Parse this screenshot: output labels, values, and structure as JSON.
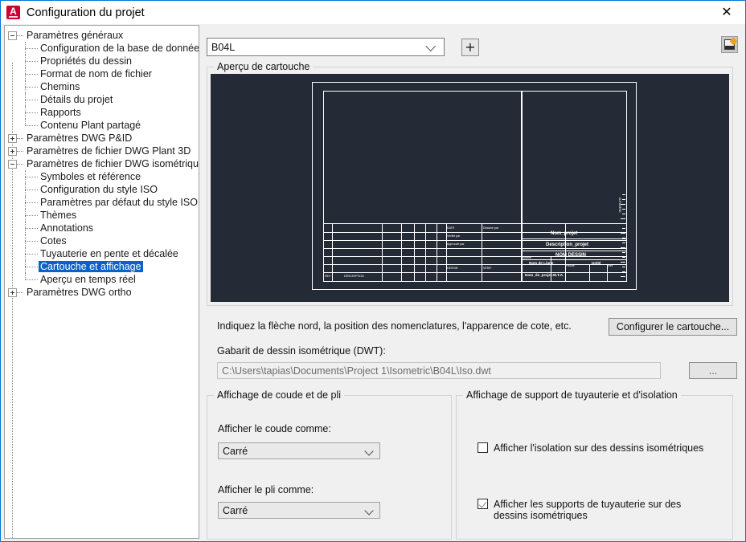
{
  "window": {
    "title": "Configuration du projet",
    "app_icon": "autocad-a-icon",
    "close_label": "✕"
  },
  "tree": {
    "items": [
      {
        "label": "Paramètres généraux",
        "level": 0,
        "toggle": "minus",
        "selected": false
      },
      {
        "label": "Configuration de la base de données",
        "level": 1,
        "toggle": "none",
        "selected": false
      },
      {
        "label": "Propriétés du dessin",
        "level": 1,
        "toggle": "none",
        "selected": false
      },
      {
        "label": "Format de nom de fichier",
        "level": 1,
        "toggle": "none",
        "selected": false
      },
      {
        "label": "Chemins",
        "level": 1,
        "toggle": "none",
        "selected": false
      },
      {
        "label": "Détails du projet",
        "level": 1,
        "toggle": "none",
        "selected": false
      },
      {
        "label": "Rapports",
        "level": 1,
        "toggle": "none",
        "selected": false
      },
      {
        "label": "Contenu Plant partagé",
        "level": 1,
        "toggle": "none",
        "selected": false
      },
      {
        "label": "Paramètres DWG P&ID",
        "level": 0,
        "toggle": "plus",
        "selected": false
      },
      {
        "label": "Paramètres de fichier DWG Plant 3D",
        "level": 0,
        "toggle": "plus",
        "selected": false
      },
      {
        "label": "Paramètres de fichier DWG isométrique",
        "level": 0,
        "toggle": "minus",
        "selected": false
      },
      {
        "label": "Symboles et référence",
        "level": 1,
        "toggle": "none",
        "selected": false
      },
      {
        "label": "Configuration du style ISO",
        "level": 1,
        "toggle": "none",
        "selected": false
      },
      {
        "label": "Paramètres par défaut du style ISO",
        "level": 1,
        "toggle": "none",
        "selected": false
      },
      {
        "label": "Thèmes",
        "level": 1,
        "toggle": "none",
        "selected": false
      },
      {
        "label": "Annotations",
        "level": 1,
        "toggle": "none",
        "selected": false
      },
      {
        "label": "Cotes",
        "level": 1,
        "toggle": "none",
        "selected": false
      },
      {
        "label": "Tuyauterie en pente et décalée",
        "level": 1,
        "toggle": "none",
        "selected": false
      },
      {
        "label": "Cartouche et affichage",
        "level": 1,
        "toggle": "none",
        "selected": true
      },
      {
        "label": "Aperçu en temps réel",
        "level": 1,
        "toggle": "none",
        "selected": false
      },
      {
        "label": "Paramètres DWG ortho",
        "level": 0,
        "toggle": "plus",
        "selected": false
      }
    ]
  },
  "toolbar": {
    "style_combo_value": "B04L",
    "add_button_label": "+",
    "help_icon": "drawing-sheet-icon"
  },
  "preview": {
    "legend": "Aperçu de cartouche",
    "background_color": "#252b36",
    "line_color": "#ffffff",
    "titleblock_fields": [
      "Nom_projet",
      "Description_projet",
      "NOM DESSIN",
      "Nom de Ligne",
      "Unité",
      "Nom_de_projet-M.T.A."
    ],
    "titleblock_small_labels": [
      "REV",
      "DESCRIPTION",
      "DATE",
      "DESSIN",
      "VERIF",
      "APPROB",
      "Dessiné par",
      "Vérifié par",
      "Approuvé par",
      "Echelle",
      "Feuille",
      "Rev"
    ]
  },
  "hint": {
    "text": "Indiquez la flèche nord, la position des nomenclatures, l'apparence de cote, etc.",
    "configure_button": "Configurer le cartouche..."
  },
  "template": {
    "label": "Gabarit de dessin isométrique (DWT):",
    "path_value": "C:\\Users\\tapias\\Documents\\Project 1\\Isometric\\B04L\\Iso.dwt",
    "browse_button": "..."
  },
  "bend_group": {
    "legend": "Affichage de coude et de pli",
    "bend_label": "Afficher le coude comme:",
    "bend_value": "Carré",
    "fold_label": "Afficher le pli comme:",
    "fold_value": "Carré"
  },
  "support_group": {
    "legend": "Affichage de support de tuyauterie et d'isolation",
    "insulation_label": "Afficher l'isolation sur des dessins isométriques",
    "insulation_checked": false,
    "supports_label": "Afficher les supports de tuyauterie sur des dessins isométriques",
    "supports_checked": true
  },
  "colors": {
    "accent": "#0078d7",
    "selection": "#0a62c8",
    "dialog_bg": "#f0f0f0",
    "preview_bg": "#252b36"
  }
}
